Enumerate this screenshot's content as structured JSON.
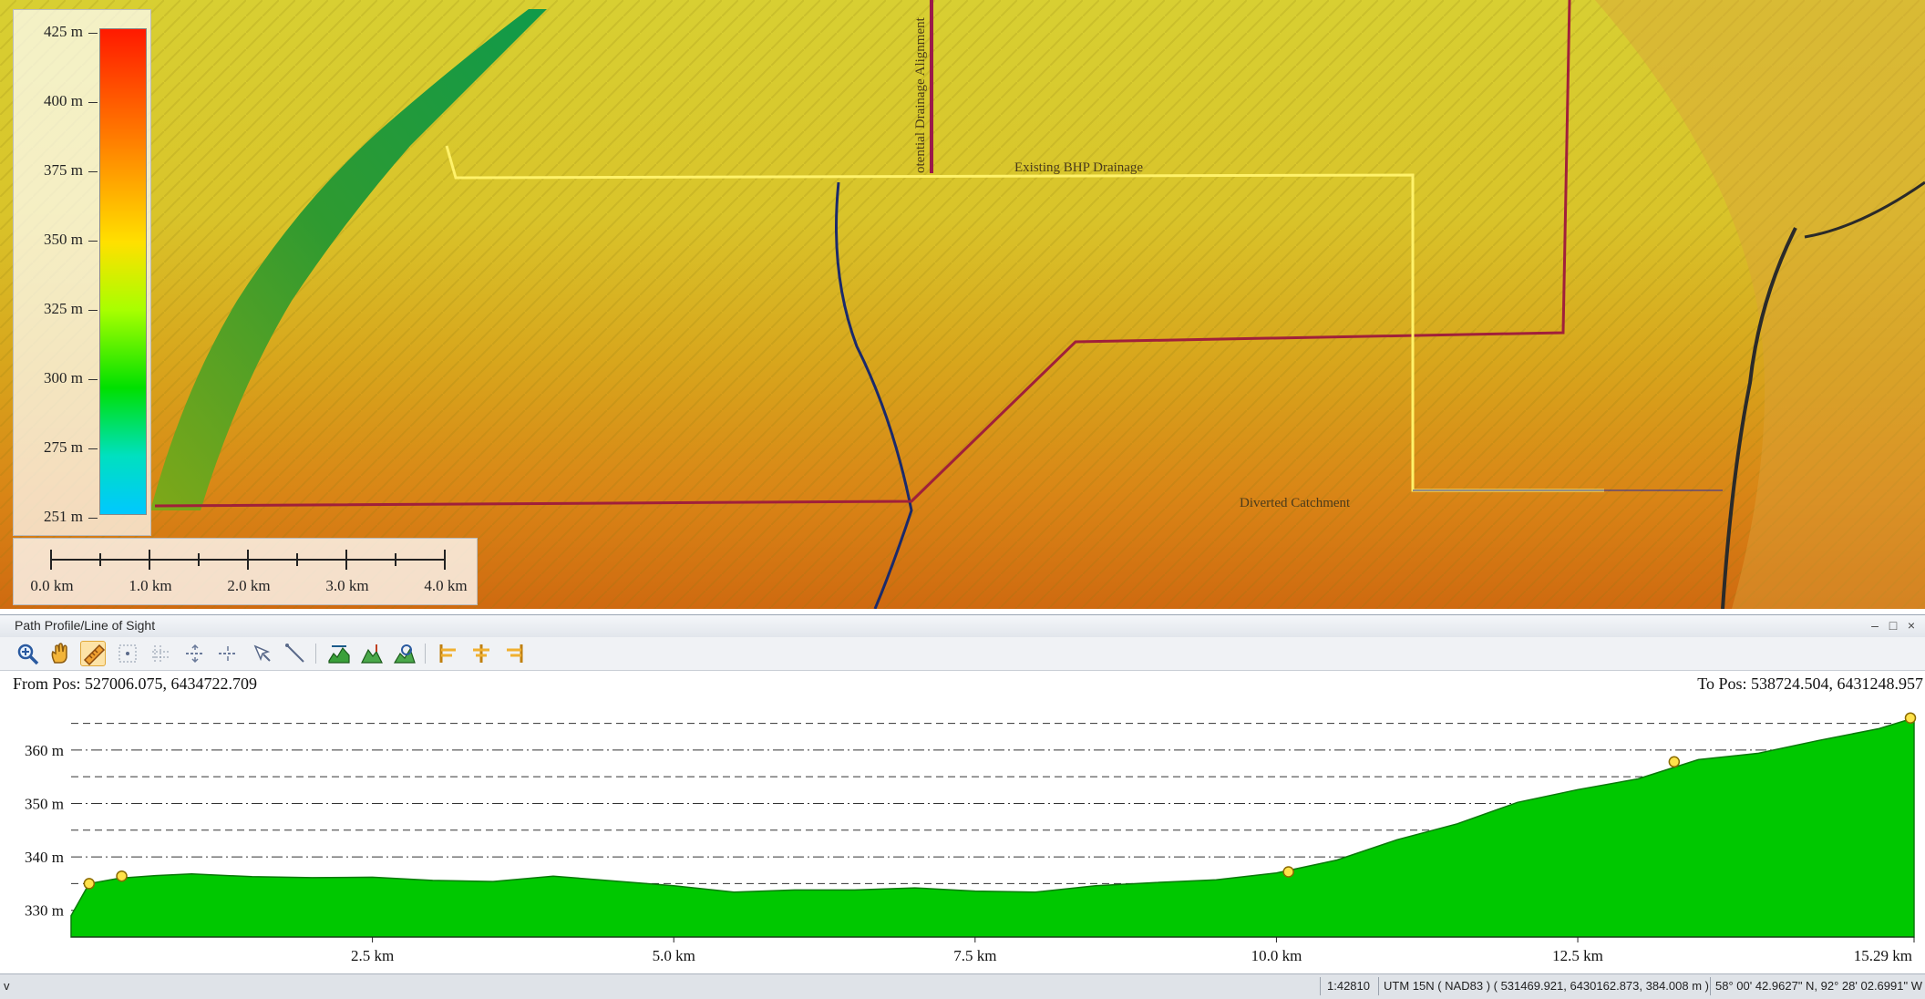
{
  "legend": {
    "ticks": [
      "425 m",
      "400 m",
      "375 m",
      "350 m",
      "325 m",
      "300 m",
      "275 m",
      "251 m"
    ]
  },
  "scale_bar": {
    "labels": [
      "0.0 km",
      "1.0 km",
      "2.0 km",
      "3.0 km",
      "4.0 km"
    ]
  },
  "map_labels": {
    "existing_drainage": "Existing BHP Drainage",
    "potential_alignment": "otential Drainage Alignment",
    "diverted_catchment": "Diverted Catchment"
  },
  "panel": {
    "title": "Path Profile/Line of Sight",
    "min_label": "–",
    "max_label": "□",
    "close_label": "×"
  },
  "toolbar": {
    "tools": [
      "zoom-in-icon",
      "pan-hand-icon",
      "measure-ruler-icon",
      "grid-points-icon",
      "grid-lines-icon",
      "horizontal-split-icon",
      "horizontal-split-alt-icon",
      "pointer-select-icon",
      "line-draw-icon",
      "terrain-profile-icon",
      "terrain-fill-icon",
      "line-of-sight-icon",
      "fresnel-zone-icon",
      "path-align-icon",
      "path-reverse-icon"
    ],
    "active_tool": "measure-ruler-icon"
  },
  "profile": {
    "from_pos": "From Pos: 527006.075, 6434722.709",
    "to_pos": "To Pos: 538724.504, 6431248.957"
  },
  "chart_data": {
    "type": "area",
    "title": "",
    "xlabel": "",
    "ylabel": "",
    "x_unit": "km",
    "y_unit": "m",
    "xlim": [
      0,
      15.29
    ],
    "ylim": [
      325,
      368
    ],
    "x_ticks": [
      2.5,
      5.0,
      7.5,
      10.0,
      12.5,
      15.29
    ],
    "x_tick_labels": [
      "2.5 km",
      "5.0 km",
      "7.5 km",
      "10.0 km",
      "12.5 km",
      "15.29 km"
    ],
    "y_ticks": [
      330,
      340,
      350,
      360
    ],
    "y_tick_labels": [
      "330 m",
      "340 m",
      "350 m",
      "360 m"
    ],
    "grid": true,
    "fill_color": "#00c800",
    "series": [
      {
        "x": [
          0,
          0.15,
          0.4,
          0.7,
          1.0,
          1.5,
          2.0,
          2.5,
          3.0,
          3.5,
          4.0,
          4.5,
          5.0,
          5.5,
          6.0,
          6.5,
          7.0,
          7.5,
          8.0,
          8.5,
          9.0,
          9.5,
          10.0,
          10.5,
          11.0,
          11.5,
          12.0,
          12.5,
          13.0,
          13.5,
          14.0,
          14.5,
          15.0,
          15.29
        ],
        "y": [
          329,
          335,
          336,
          336.5,
          336.8,
          336.3,
          336.1,
          336.2,
          335.6,
          335.4,
          336.4,
          335.5,
          334.6,
          333.4,
          333.8,
          333.8,
          334.2,
          333.6,
          333.4,
          334.6,
          335.2,
          335.7,
          337.0,
          339.4,
          343.2,
          346.2,
          350.2,
          352.6,
          354.6,
          358.2,
          359.4,
          361.8,
          364.0,
          366.0
        ]
      }
    ],
    "markers": [
      {
        "x": 0.15,
        "y": 335.0
      },
      {
        "x": 0.42,
        "y": 336.4
      },
      {
        "x": 10.1,
        "y": 337.2
      },
      {
        "x": 13.3,
        "y": 357.8
      },
      {
        "x": 15.29,
        "y": 366.0
      }
    ]
  },
  "status": {
    "left": "v",
    "scale": "1:42810",
    "coords": "UTM 15N ( NAD83 ) ( 531469.921, 6430162.873, 384.008 m )",
    "latlon": "58° 00' 42.9627\" N, 92° 28' 02.6991\" W"
  }
}
